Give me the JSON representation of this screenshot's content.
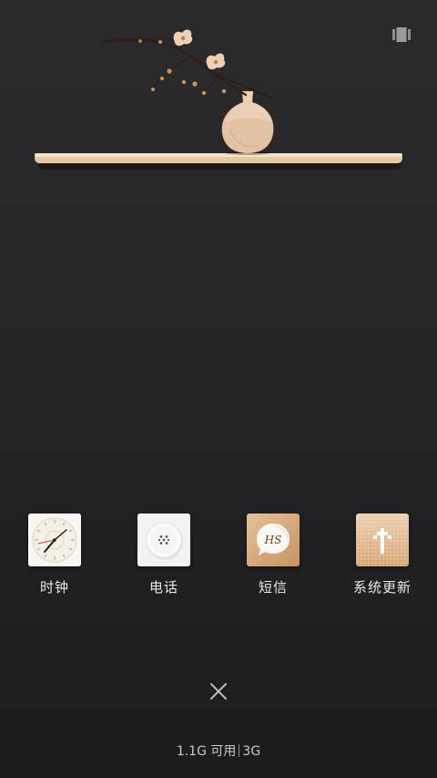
{
  "recents": {
    "apps": [
      {
        "label": "时钟",
        "icon": "clock-icon"
      },
      {
        "label": "电话",
        "icon": "phone-icon"
      },
      {
        "label": "短信",
        "icon": "message-icon"
      },
      {
        "label": "系统更新",
        "icon": "system-update-icon"
      }
    ],
    "close_icon": "close-icon",
    "corner_icon": "multitask-icon"
  },
  "memory": {
    "available": "1.1G 可用",
    "total": "3G"
  },
  "colors": {
    "background": "#262628",
    "shelf": "#e8c9a6",
    "label": "#e9e9e9",
    "accent_gold": "#d9b38a"
  }
}
